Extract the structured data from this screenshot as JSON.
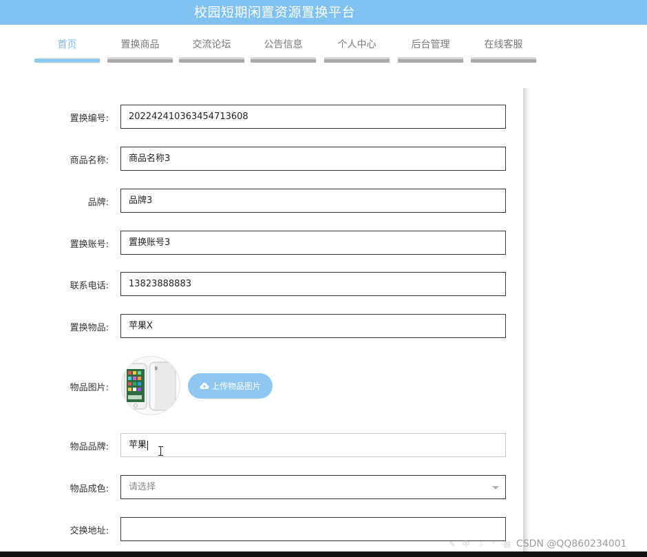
{
  "header": {
    "title": "校园短期闲置资源置换平台"
  },
  "nav": {
    "items": [
      {
        "label": "首页",
        "active": true
      },
      {
        "label": "置换商品",
        "active": false
      },
      {
        "label": "交流论坛",
        "active": false
      },
      {
        "label": "公告信息",
        "active": false
      },
      {
        "label": "个人中心",
        "active": false
      },
      {
        "label": "后台管理",
        "active": false
      },
      {
        "label": "在线客服",
        "active": false
      }
    ]
  },
  "form": {
    "exchange_no": {
      "label": "置换编号:",
      "value": "202242410363454713608"
    },
    "product_name": {
      "label": "商品名称:",
      "value": "商品名称3"
    },
    "brand": {
      "label": "品牌:",
      "value": "品牌3"
    },
    "exchange_account": {
      "label": "置换账号:",
      "value": "置换账号3"
    },
    "phone": {
      "label": "联系电话:",
      "value": "13823888883"
    },
    "exchange_item": {
      "label": "置换物品:",
      "value": "苹果X"
    },
    "item_image": {
      "label": "物品图片:",
      "icon": "phone-thumbnail",
      "upload_label": "上传物品图片",
      "upload_icon": "cloud-upload-icon"
    },
    "item_brand": {
      "label": "物品品牌:",
      "value": "苹果"
    },
    "item_condition": {
      "label": "物品成色:",
      "placeholder": "请选择",
      "icon": "chevron-down-icon"
    },
    "exchange_address": {
      "label": "交换地址:",
      "value": ""
    }
  },
  "watermark": {
    "text": "CSDN @QQ860234001"
  },
  "colors": {
    "header": "#7fc1f0",
    "accent": "#8ec7f2",
    "nav_inactive": "#a9a9a9"
  }
}
